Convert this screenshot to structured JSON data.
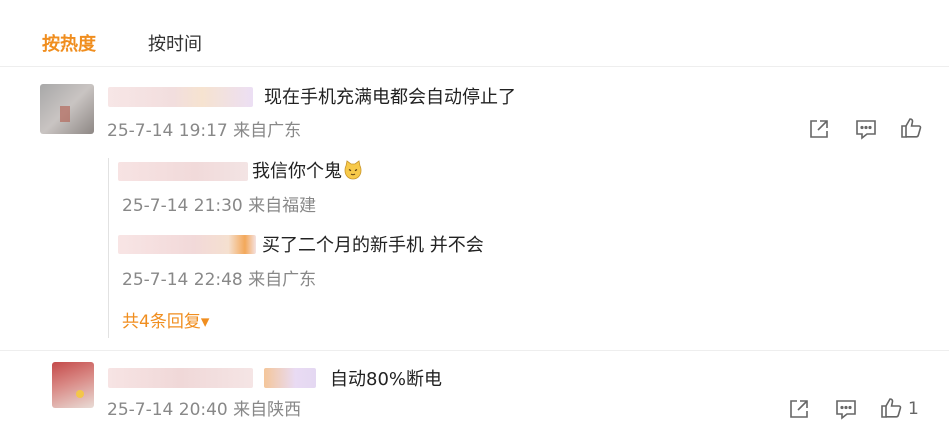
{
  "sort_tabs": {
    "hot": "按热度",
    "time": "按时间"
  },
  "colors": {
    "accent": "#f08e1f",
    "meta": "#888888",
    "icon": "#666666"
  },
  "comments": [
    {
      "text": "现在手机充满电都会自动停止了",
      "meta": "25-7-14 19:17 来自广东",
      "actions": [
        "share-icon",
        "comment-icon",
        "like-icon"
      ]
    },
    {
      "text": "自动80%断电",
      "meta": "25-7-14 20:40 来自陕西",
      "actions": [
        "share-icon",
        "comment-icon",
        "like-icon"
      ],
      "like_count": "1"
    }
  ],
  "replies": [
    {
      "text": "我信你个鬼",
      "emoji": "cat-emoji",
      "meta": "25-7-14 21:30 来自福建"
    },
    {
      "text": "买了二个月的新手机 并不会",
      "meta": "25-7-14 22:48 来自广东"
    }
  ],
  "more_replies": "共4条回复▾"
}
